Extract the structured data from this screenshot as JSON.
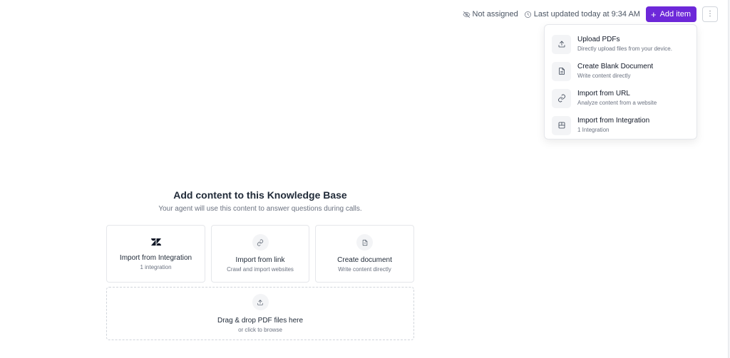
{
  "header": {
    "assignment": "Not assigned",
    "last_updated": "Last updated today at 9:34 AM",
    "add_item_label": "Add item",
    "more_label": "⋮"
  },
  "menu": {
    "items": [
      {
        "title": "Upload PDFs",
        "subtitle": "Directly upload files from your device.",
        "icon": "upload-icon"
      },
      {
        "title": "Create Blank Document",
        "subtitle": "Write content directly",
        "icon": "document-icon"
      },
      {
        "title": "Import from URL",
        "subtitle": "Analyze content from a website",
        "icon": "link-icon"
      },
      {
        "title": "Import from Integration",
        "subtitle": "1 Integration",
        "icon": "integration-icon"
      }
    ]
  },
  "empty_state": {
    "title": "Add content to this Knowledge Base",
    "subtitle": "Your agent will use this content to answer questions during calls.",
    "cards": [
      {
        "title": "Import from Integration",
        "subtitle": "1 integration",
        "icon": "zendesk-icon"
      },
      {
        "title": "Import from link",
        "subtitle": "Crawl and import websites",
        "icon": "link-icon"
      },
      {
        "title": "Create document",
        "subtitle": "Write content directly",
        "icon": "document-icon"
      }
    ],
    "dropzone": {
      "title": "Drag & drop PDF files here",
      "subtitle": "or click to browse",
      "icon": "upload-icon"
    }
  },
  "colors": {
    "accent": "#6d28d9",
    "border": "#e5e7eb",
    "muted_text": "#6b7280"
  }
}
